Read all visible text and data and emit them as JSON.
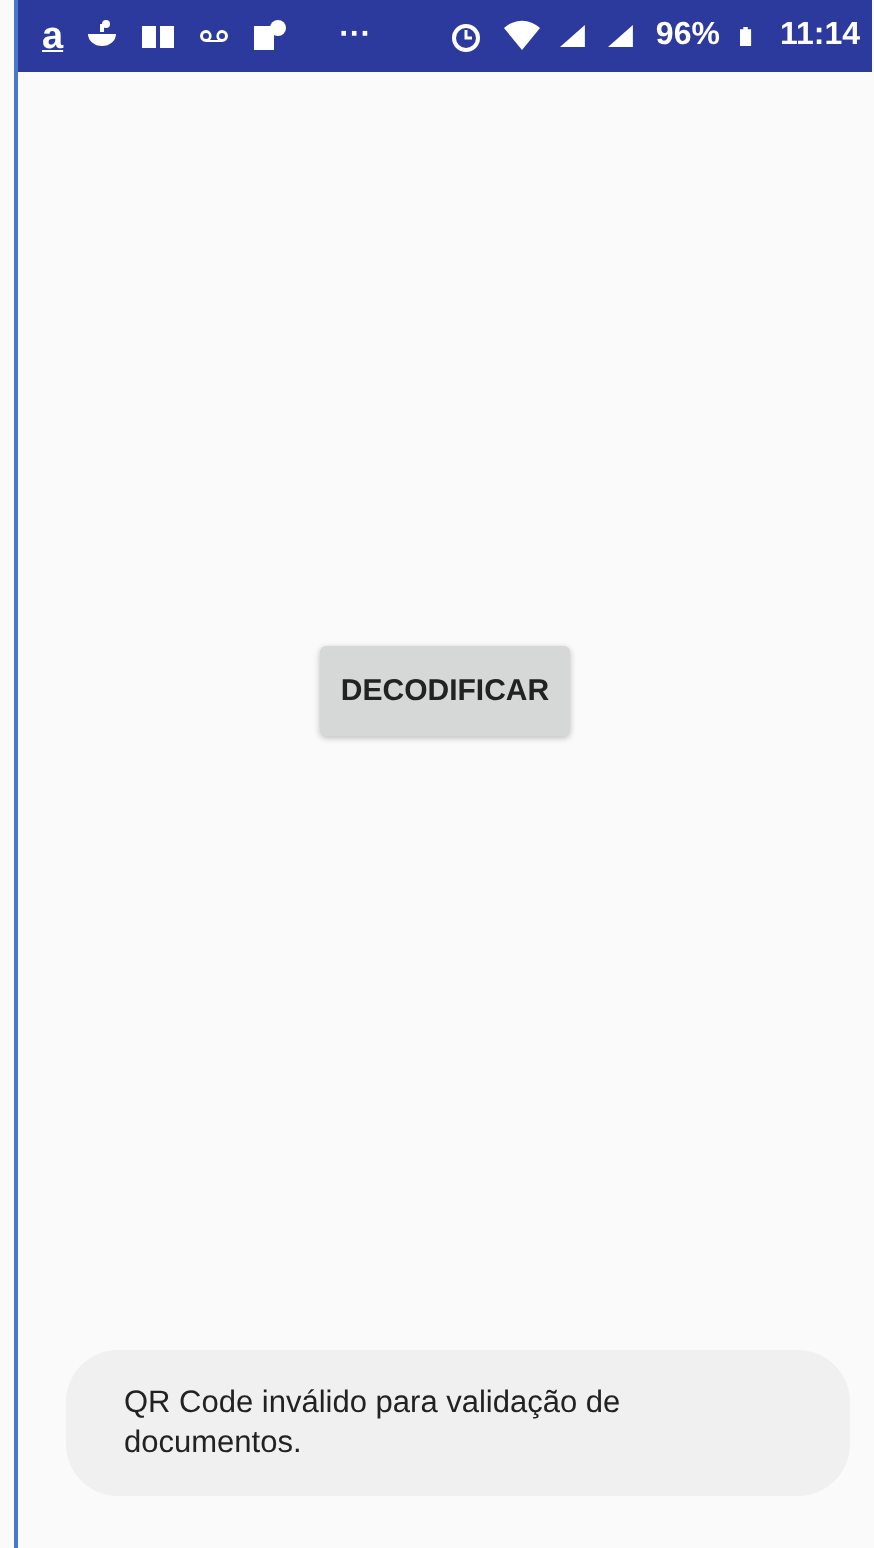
{
  "status_bar": {
    "app_glyph": "a",
    "more": "···",
    "battery_percent": "96%",
    "time": "11:14"
  },
  "button": {
    "label": "DECODIFICAR"
  },
  "toast": {
    "message": "QR Code inválido para validação de documentos."
  }
}
